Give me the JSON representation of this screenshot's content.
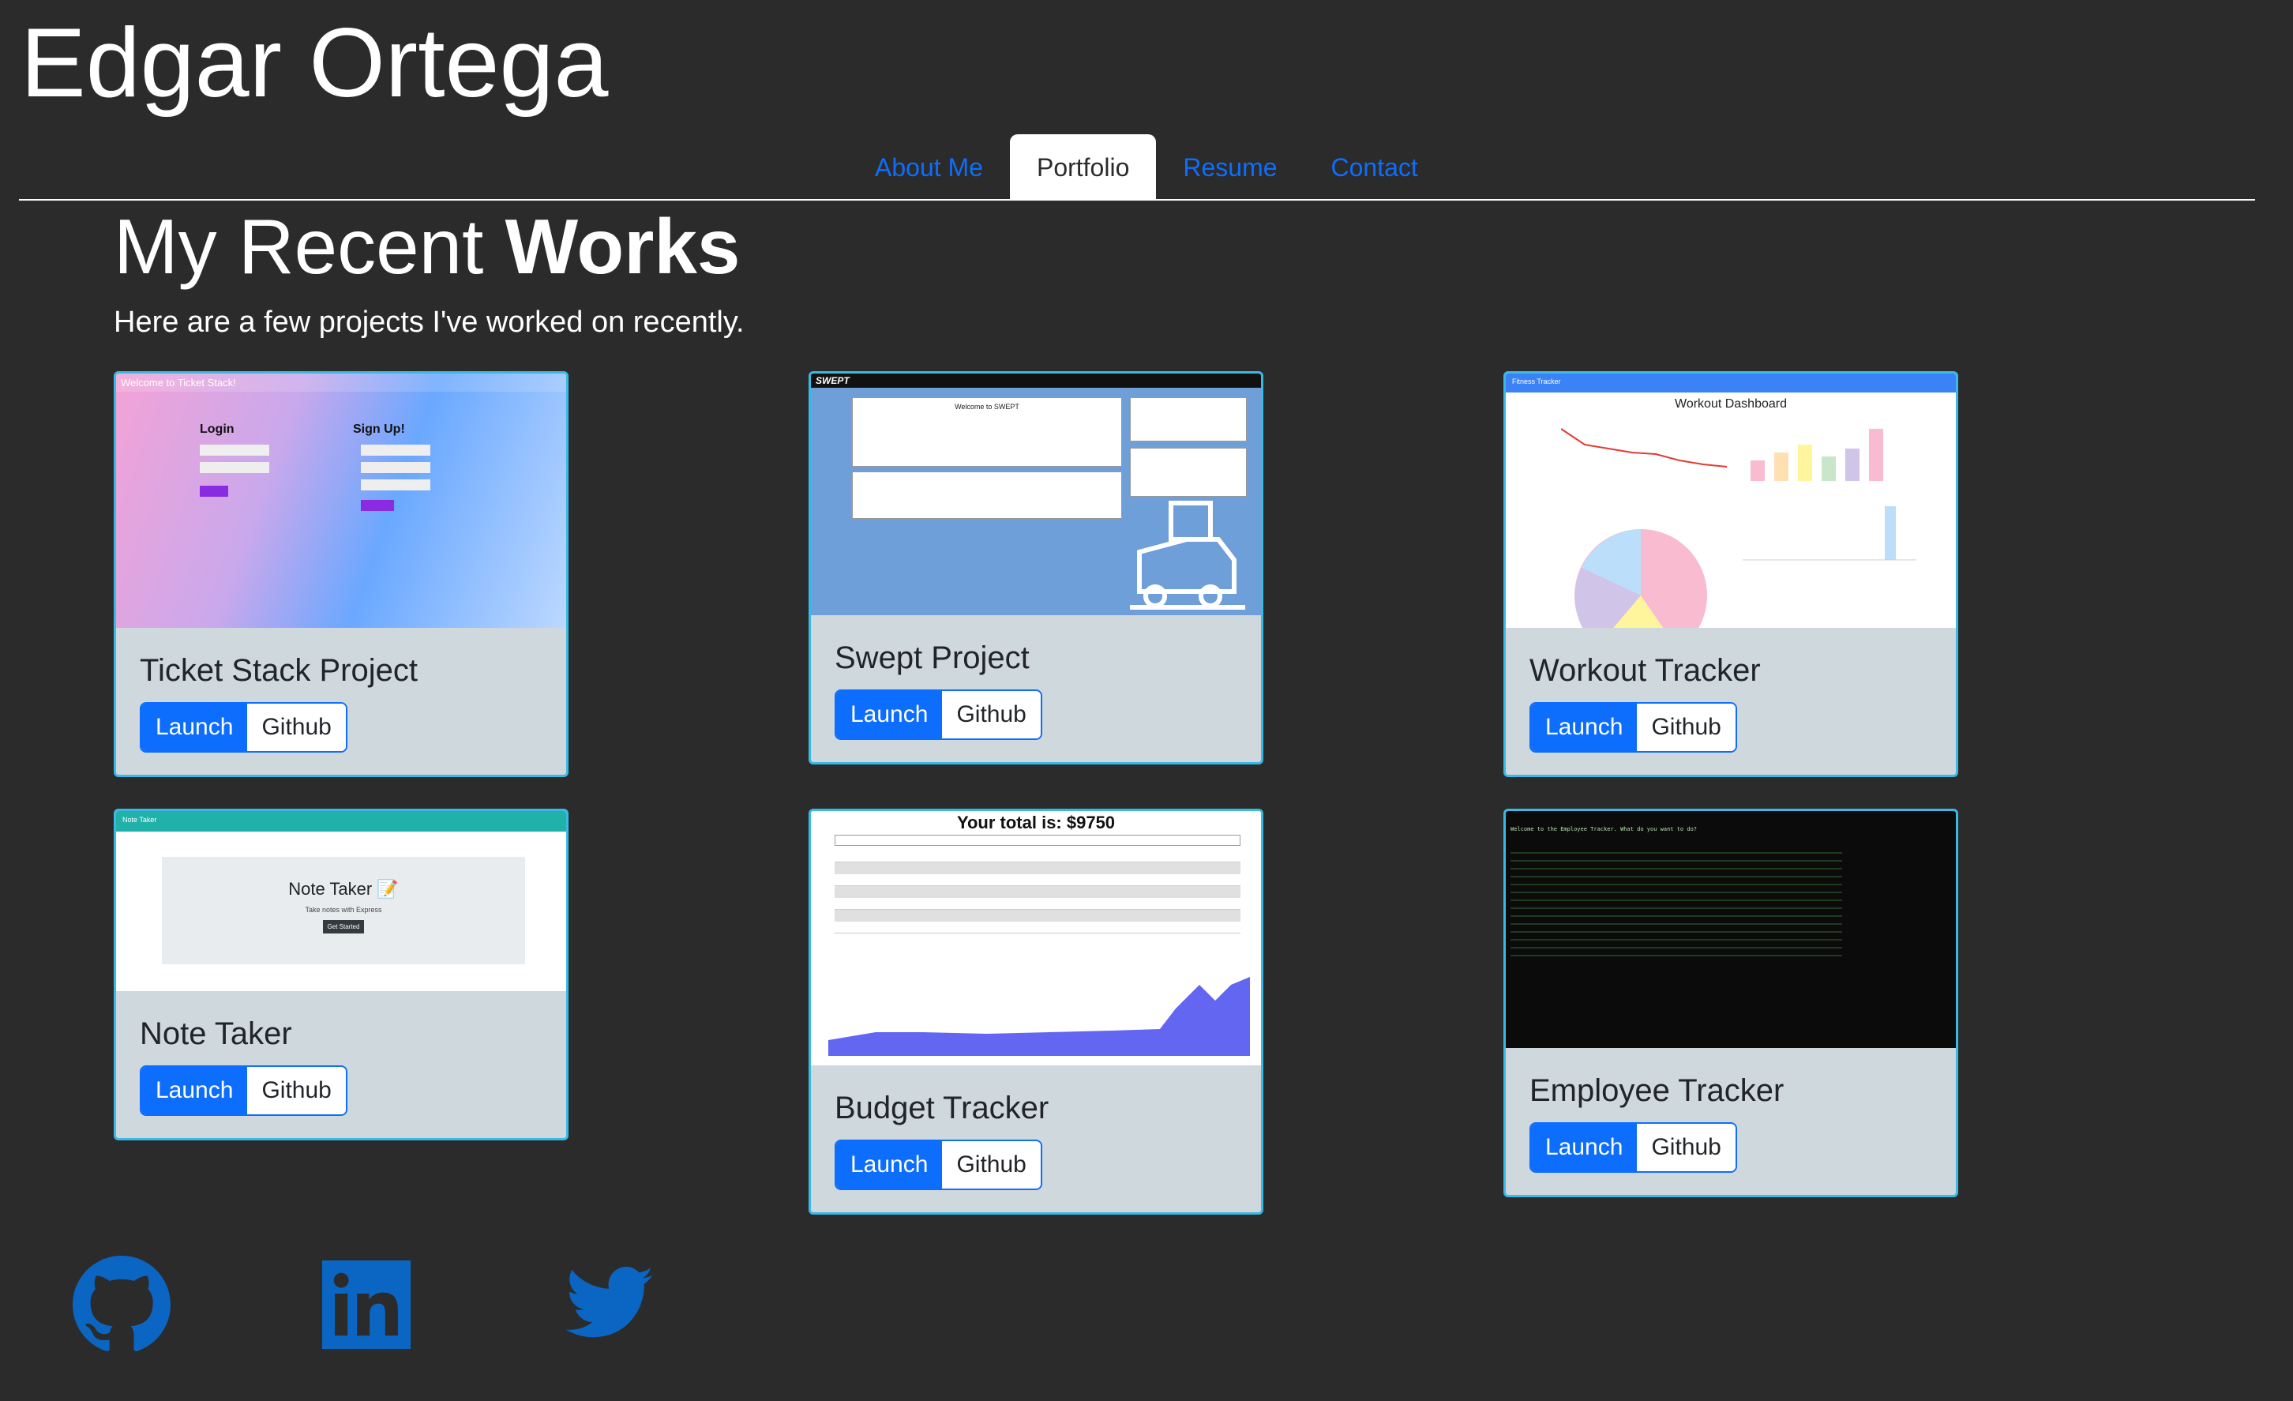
{
  "header": {
    "name": "Edgar Ortega"
  },
  "nav": {
    "items": [
      {
        "label": "About Me"
      },
      {
        "label": "Portfolio"
      },
      {
        "label": "Resume"
      },
      {
        "label": "Contact"
      }
    ],
    "active": "Portfolio"
  },
  "section": {
    "title_light": "My Recent ",
    "title_bold": "Works",
    "subtitle": "Here are a few projects I've worked on recently."
  },
  "projects": [
    {
      "title": "Ticket Stack Project",
      "launch_label": "Launch",
      "github_label": "Github",
      "thumb": {
        "banner": "Welcome to Ticket Stack!",
        "login": "Login",
        "signup": "Sign Up!"
      }
    },
    {
      "title": "Swept Project",
      "launch_label": "Launch",
      "github_label": "Github",
      "thumb": {
        "brand": "SWEPT",
        "welcome": "Welcome to SWEPT"
      }
    },
    {
      "title": "Workout Tracker",
      "launch_label": "Launch",
      "github_label": "Github",
      "thumb": {
        "nav": "Fitness Tracker",
        "heading": "Workout Dashboard"
      }
    },
    {
      "title": "Note Taker",
      "launch_label": "Launch",
      "github_label": "Github",
      "thumb": {
        "nav": "Note Taker",
        "heading": "Note Taker 📝",
        "sub": "Take notes with Express",
        "button": "Get Started"
      }
    },
    {
      "title": "Budget Tracker",
      "launch_label": "Launch",
      "github_label": "Github",
      "thumb": {
        "total": "Your total is: $9750"
      }
    },
    {
      "title": "Employee Tracker",
      "launch_label": "Launch",
      "github_label": "Github",
      "thumb": {
        "line": "Welcome to the Employee Tracker. What do you want to do?"
      }
    }
  ],
  "social": {
    "icons": [
      "github-icon",
      "linkedin-icon",
      "twitter-icon"
    ],
    "color": "#0a66c2"
  },
  "colors": {
    "background": "#2b2b2b",
    "accent": "#0d6efd",
    "card": "#cfd8dc",
    "card_border": "#39b9e6"
  }
}
